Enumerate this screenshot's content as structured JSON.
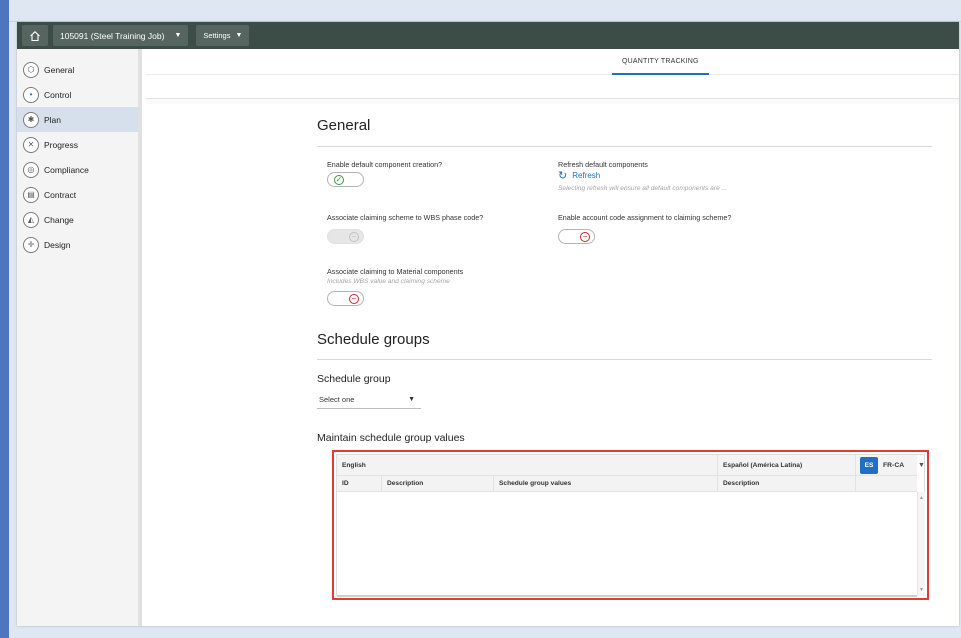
{
  "topbar": {
    "job_label": "105091 (Steel Training Job)",
    "settings_label": "Settings"
  },
  "sidebar": {
    "items": [
      {
        "label": "General",
        "icon": "hexagon-icon"
      },
      {
        "label": "Control",
        "icon": "control-icon"
      },
      {
        "label": "Plan",
        "icon": "plan-icon",
        "active": true
      },
      {
        "label": "Progress",
        "icon": "progress-icon"
      },
      {
        "label": "Compliance",
        "icon": "compliance-icon"
      },
      {
        "label": "Contract",
        "icon": "contract-icon"
      },
      {
        "label": "Change",
        "icon": "change-icon"
      },
      {
        "label": "Design",
        "icon": "design-icon"
      }
    ]
  },
  "tabs": {
    "quantity_tracking": "QUANTITY TRACKING"
  },
  "general": {
    "title": "General",
    "enable_default": {
      "label": "Enable default component creation?",
      "state": "on"
    },
    "refresh_defaults": {
      "label": "Refresh default components",
      "link": "Refresh",
      "hint": "Selecting refresh will ensure all default components are ..."
    },
    "associate_wbs": {
      "label": "Associate claiming scheme to WBS phase code?",
      "state": "disabled"
    },
    "enable_account": {
      "label": "Enable account code assignment to claiming scheme?",
      "state": "off"
    },
    "associate_material": {
      "label": "Associate claiming to Material components",
      "hint": "Includes WBS value and claiming scheme",
      "state": "off"
    }
  },
  "schedule_groups": {
    "title": "Schedule groups",
    "group_label": "Schedule group",
    "select_value": "Select one",
    "maintain_title": "Maintain schedule group values",
    "grid": {
      "lang_english": "English",
      "lang_spanish": "Español (América Latina)",
      "badge_es": "ES",
      "badge_frca": "FR-CA",
      "columns": [
        "ID",
        "Description",
        "Schedule group values",
        "Description"
      ]
    }
  },
  "colors": {
    "accent": "#1f6fc4",
    "topbar": "#3c4c47",
    "highlight": "#e53935"
  }
}
